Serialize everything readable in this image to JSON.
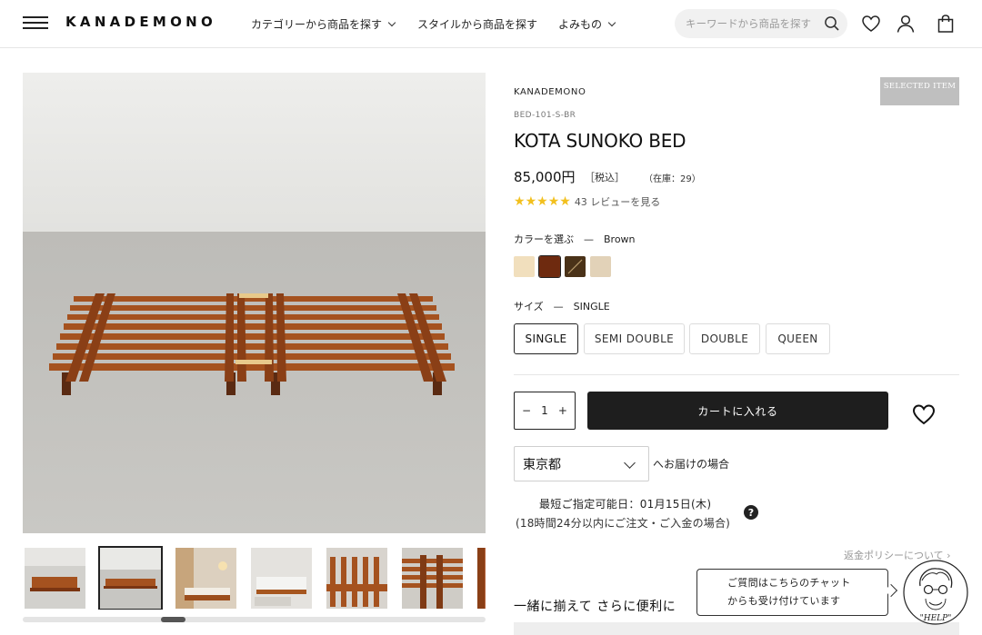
{
  "header": {
    "logo": "KANADEMONO",
    "nav": [
      {
        "label": "カテゴリーから商品を探す",
        "has_dropdown": true
      },
      {
        "label": "スタイルから商品を探す",
        "has_dropdown": false
      },
      {
        "label": "よみもの",
        "has_dropdown": true
      }
    ],
    "search_placeholder": "キーワードから商品を探す",
    "icons": [
      "menu-icon",
      "search-icon",
      "heart-icon",
      "user-icon",
      "bag-icon"
    ]
  },
  "gallery": {
    "thumbnail_count": 7,
    "active_thumbnail": 2
  },
  "product": {
    "brand": "KANADEMONO",
    "badge": "SELECTED ITEM",
    "sku": "BED-101-S-BR",
    "title": "KOTA SUNOKO BED",
    "price": "85,000円",
    "tax": "［税込］",
    "stock": "（在庫：29）",
    "rating": 5,
    "review_text": "43 レビューを見る",
    "color_label": "カラーを選ぶ　—　Brown",
    "colors": [
      {
        "name": "natural",
        "hex": "#f1dfbd"
      },
      {
        "name": "brown",
        "hex": "#6e2a0f",
        "selected": true
      },
      {
        "name": "dark-brown",
        "hex": "#4a3218"
      },
      {
        "name": "beige",
        "hex": "#e2d2b8"
      }
    ],
    "size_label": "サイズ　—　SINGLE",
    "sizes": [
      {
        "label": "SINGLE",
        "selected": true
      },
      {
        "label": "SEMI DOUBLE",
        "selected": false
      },
      {
        "label": "DOUBLE",
        "selected": false
      },
      {
        "label": "QUEEN",
        "selected": false
      }
    ],
    "quantity": "1",
    "qty_minus": "−",
    "qty_plus": "+",
    "cart_button": "カートに入れる",
    "prefecture": "東京都",
    "prefecture_suffix": "へお届けの場合",
    "delivery_date": "最短ご指定可能日：01月15日(木)",
    "delivery_note": "(18時間24分以内にご注文・ご入金の場合)",
    "help_mark": "?",
    "return_policy": "返金ポリシーについて ›",
    "recommend_title": "一緒に揃えて さらに便利に"
  },
  "chat": {
    "line1": "ご質問はこちらのチャット",
    "line2": "からも受け付けています",
    "avatar_text": "\"HELP\""
  },
  "colors": {
    "accent_dark": "#1e1e1e",
    "star": "#f2c01e",
    "badge_bg": "#bfbfbf"
  }
}
